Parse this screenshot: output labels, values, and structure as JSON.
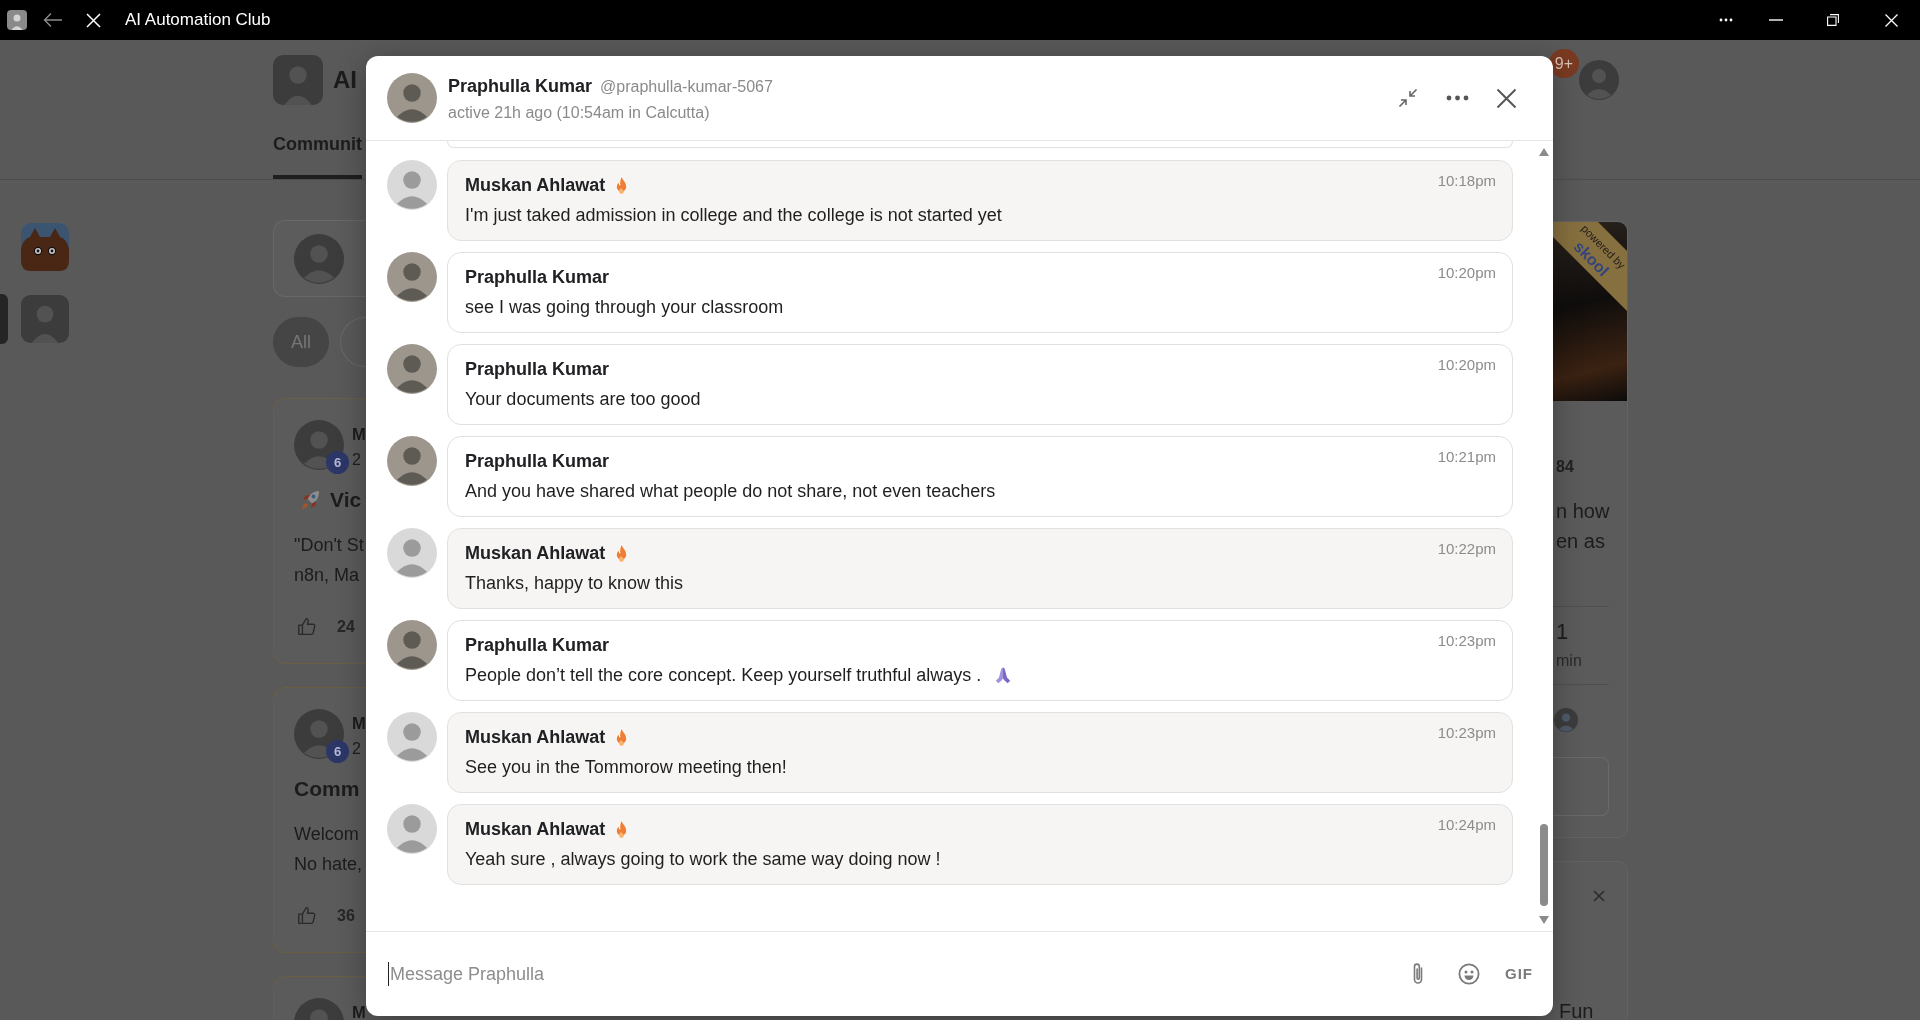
{
  "title_bar": {
    "title": "AI Automation Club"
  },
  "community_header": {
    "name": "AI",
    "tabs": [
      {
        "label": "Communit",
        "selected": true
      }
    ],
    "notification_count": "9+"
  },
  "left_rail": {
    "items": [
      {
        "kind": "logo",
        "selected": false
      },
      {
        "kind": "avatar",
        "selected": true
      }
    ]
  },
  "feed": {
    "filters": [
      {
        "label": "All",
        "selected": true
      },
      {
        "selected": false
      }
    ],
    "posts": [
      {
        "author": "M",
        "time": "2",
        "badge": "6",
        "title": "Vic",
        "title_icon": true,
        "body_lines": [
          "\"Don't St",
          "n8n, Ma"
        ],
        "likes": "24"
      },
      {
        "author": "M",
        "time": "2",
        "badge": "6",
        "title": "Comm",
        "title_icon": false,
        "body_lines": [
          "Welcom",
          "No hate,"
        ],
        "likes": "36"
      },
      {
        "author": "M"
      }
    ]
  },
  "sidebar": {
    "ribbon": {
      "caption": "powered by",
      "logo": "skool"
    },
    "count": "84",
    "description_lines": [
      "n how",
      "en as"
    ],
    "stat": {
      "value": "1",
      "label": "min"
    },
    "notice": {
      "text": "Fun"
    }
  },
  "chat": {
    "contact": {
      "name": "Praphulla Kumar",
      "handle": "@praphulla-kumar-5067",
      "status": "active 21h ago (10:54am in Calcutta)"
    },
    "messages": [
      {
        "author": "Muskan Ahlawat",
        "mine": true,
        "streak": true,
        "time": "10:18pm",
        "text": "I'm just taked admission in college and the college is not started yet",
        "trailing_emoji": false
      },
      {
        "author": "Praphulla Kumar",
        "mine": false,
        "streak": false,
        "time": "10:20pm",
        "text": "see I was going through your classroom",
        "trailing_emoji": false
      },
      {
        "author": "Praphulla Kumar",
        "mine": false,
        "streak": false,
        "time": "10:20pm",
        "text": "Your documents are too good",
        "trailing_emoji": false
      },
      {
        "author": "Praphulla Kumar",
        "mine": false,
        "streak": false,
        "time": "10:21pm",
        "text": "And you have shared what people do not share, not even teachers",
        "trailing_emoji": false
      },
      {
        "author": "Muskan Ahlawat",
        "mine": true,
        "streak": true,
        "time": "10:22pm",
        "text": "Thanks, happy to know this",
        "trailing_emoji": false
      },
      {
        "author": "Praphulla Kumar",
        "mine": false,
        "streak": false,
        "time": "10:23pm",
        "text": "People don’t tell the core concept. Keep yourself truthful always .",
        "trailing_emoji": true
      },
      {
        "author": "Muskan Ahlawat",
        "mine": true,
        "streak": true,
        "time": "10:23pm",
        "text": "See you in the Tommorow meeting then!",
        "trailing_emoji": false
      },
      {
        "author": "Muskan Ahlawat",
        "mine": true,
        "streak": true,
        "time": "10:24pm",
        "text": "Yeah sure , always going to work the same way doing now !",
        "trailing_emoji": false
      }
    ],
    "composer": {
      "placeholder": "Message Praphulla",
      "gif_label": "GIF"
    }
  }
}
